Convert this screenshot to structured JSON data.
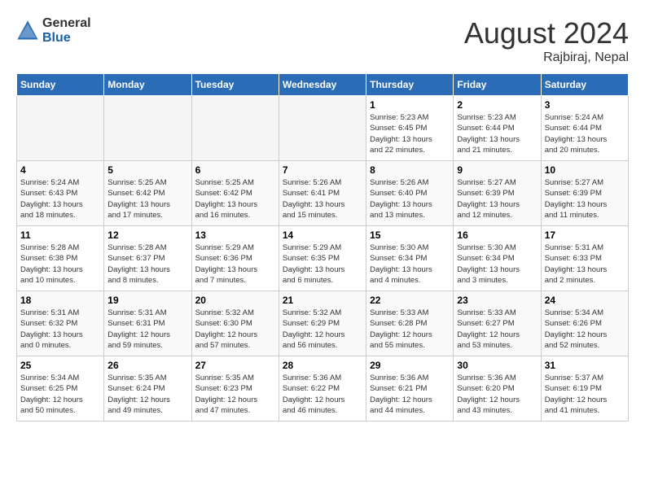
{
  "logo": {
    "general": "General",
    "blue": "Blue"
  },
  "title": "August 2024",
  "location": "Rajbiraj, Nepal",
  "days_of_week": [
    "Sunday",
    "Monday",
    "Tuesday",
    "Wednesday",
    "Thursday",
    "Friday",
    "Saturday"
  ],
  "weeks": [
    [
      {
        "day": "",
        "info": ""
      },
      {
        "day": "",
        "info": ""
      },
      {
        "day": "",
        "info": ""
      },
      {
        "day": "",
        "info": ""
      },
      {
        "day": "1",
        "info": "Sunrise: 5:23 AM\nSunset: 6:45 PM\nDaylight: 13 hours\nand 22 minutes."
      },
      {
        "day": "2",
        "info": "Sunrise: 5:23 AM\nSunset: 6:44 PM\nDaylight: 13 hours\nand 21 minutes."
      },
      {
        "day": "3",
        "info": "Sunrise: 5:24 AM\nSunset: 6:44 PM\nDaylight: 13 hours\nand 20 minutes."
      }
    ],
    [
      {
        "day": "4",
        "info": "Sunrise: 5:24 AM\nSunset: 6:43 PM\nDaylight: 13 hours\nand 18 minutes."
      },
      {
        "day": "5",
        "info": "Sunrise: 5:25 AM\nSunset: 6:42 PM\nDaylight: 13 hours\nand 17 minutes."
      },
      {
        "day": "6",
        "info": "Sunrise: 5:25 AM\nSunset: 6:42 PM\nDaylight: 13 hours\nand 16 minutes."
      },
      {
        "day": "7",
        "info": "Sunrise: 5:26 AM\nSunset: 6:41 PM\nDaylight: 13 hours\nand 15 minutes."
      },
      {
        "day": "8",
        "info": "Sunrise: 5:26 AM\nSunset: 6:40 PM\nDaylight: 13 hours\nand 13 minutes."
      },
      {
        "day": "9",
        "info": "Sunrise: 5:27 AM\nSunset: 6:39 PM\nDaylight: 13 hours\nand 12 minutes."
      },
      {
        "day": "10",
        "info": "Sunrise: 5:27 AM\nSunset: 6:39 PM\nDaylight: 13 hours\nand 11 minutes."
      }
    ],
    [
      {
        "day": "11",
        "info": "Sunrise: 5:28 AM\nSunset: 6:38 PM\nDaylight: 13 hours\nand 10 minutes."
      },
      {
        "day": "12",
        "info": "Sunrise: 5:28 AM\nSunset: 6:37 PM\nDaylight: 13 hours\nand 8 minutes."
      },
      {
        "day": "13",
        "info": "Sunrise: 5:29 AM\nSunset: 6:36 PM\nDaylight: 13 hours\nand 7 minutes."
      },
      {
        "day": "14",
        "info": "Sunrise: 5:29 AM\nSunset: 6:35 PM\nDaylight: 13 hours\nand 6 minutes."
      },
      {
        "day": "15",
        "info": "Sunrise: 5:30 AM\nSunset: 6:34 PM\nDaylight: 13 hours\nand 4 minutes."
      },
      {
        "day": "16",
        "info": "Sunrise: 5:30 AM\nSunset: 6:34 PM\nDaylight: 13 hours\nand 3 minutes."
      },
      {
        "day": "17",
        "info": "Sunrise: 5:31 AM\nSunset: 6:33 PM\nDaylight: 13 hours\nand 2 minutes."
      }
    ],
    [
      {
        "day": "18",
        "info": "Sunrise: 5:31 AM\nSunset: 6:32 PM\nDaylight: 13 hours\nand 0 minutes."
      },
      {
        "day": "19",
        "info": "Sunrise: 5:31 AM\nSunset: 6:31 PM\nDaylight: 12 hours\nand 59 minutes."
      },
      {
        "day": "20",
        "info": "Sunrise: 5:32 AM\nSunset: 6:30 PM\nDaylight: 12 hours\nand 57 minutes."
      },
      {
        "day": "21",
        "info": "Sunrise: 5:32 AM\nSunset: 6:29 PM\nDaylight: 12 hours\nand 56 minutes."
      },
      {
        "day": "22",
        "info": "Sunrise: 5:33 AM\nSunset: 6:28 PM\nDaylight: 12 hours\nand 55 minutes."
      },
      {
        "day": "23",
        "info": "Sunrise: 5:33 AM\nSunset: 6:27 PM\nDaylight: 12 hours\nand 53 minutes."
      },
      {
        "day": "24",
        "info": "Sunrise: 5:34 AM\nSunset: 6:26 PM\nDaylight: 12 hours\nand 52 minutes."
      }
    ],
    [
      {
        "day": "25",
        "info": "Sunrise: 5:34 AM\nSunset: 6:25 PM\nDaylight: 12 hours\nand 50 minutes."
      },
      {
        "day": "26",
        "info": "Sunrise: 5:35 AM\nSunset: 6:24 PM\nDaylight: 12 hours\nand 49 minutes."
      },
      {
        "day": "27",
        "info": "Sunrise: 5:35 AM\nSunset: 6:23 PM\nDaylight: 12 hours\nand 47 minutes."
      },
      {
        "day": "28",
        "info": "Sunrise: 5:36 AM\nSunset: 6:22 PM\nDaylight: 12 hours\nand 46 minutes."
      },
      {
        "day": "29",
        "info": "Sunrise: 5:36 AM\nSunset: 6:21 PM\nDaylight: 12 hours\nand 44 minutes."
      },
      {
        "day": "30",
        "info": "Sunrise: 5:36 AM\nSunset: 6:20 PM\nDaylight: 12 hours\nand 43 minutes."
      },
      {
        "day": "31",
        "info": "Sunrise: 5:37 AM\nSunset: 6:19 PM\nDaylight: 12 hours\nand 41 minutes."
      }
    ]
  ]
}
